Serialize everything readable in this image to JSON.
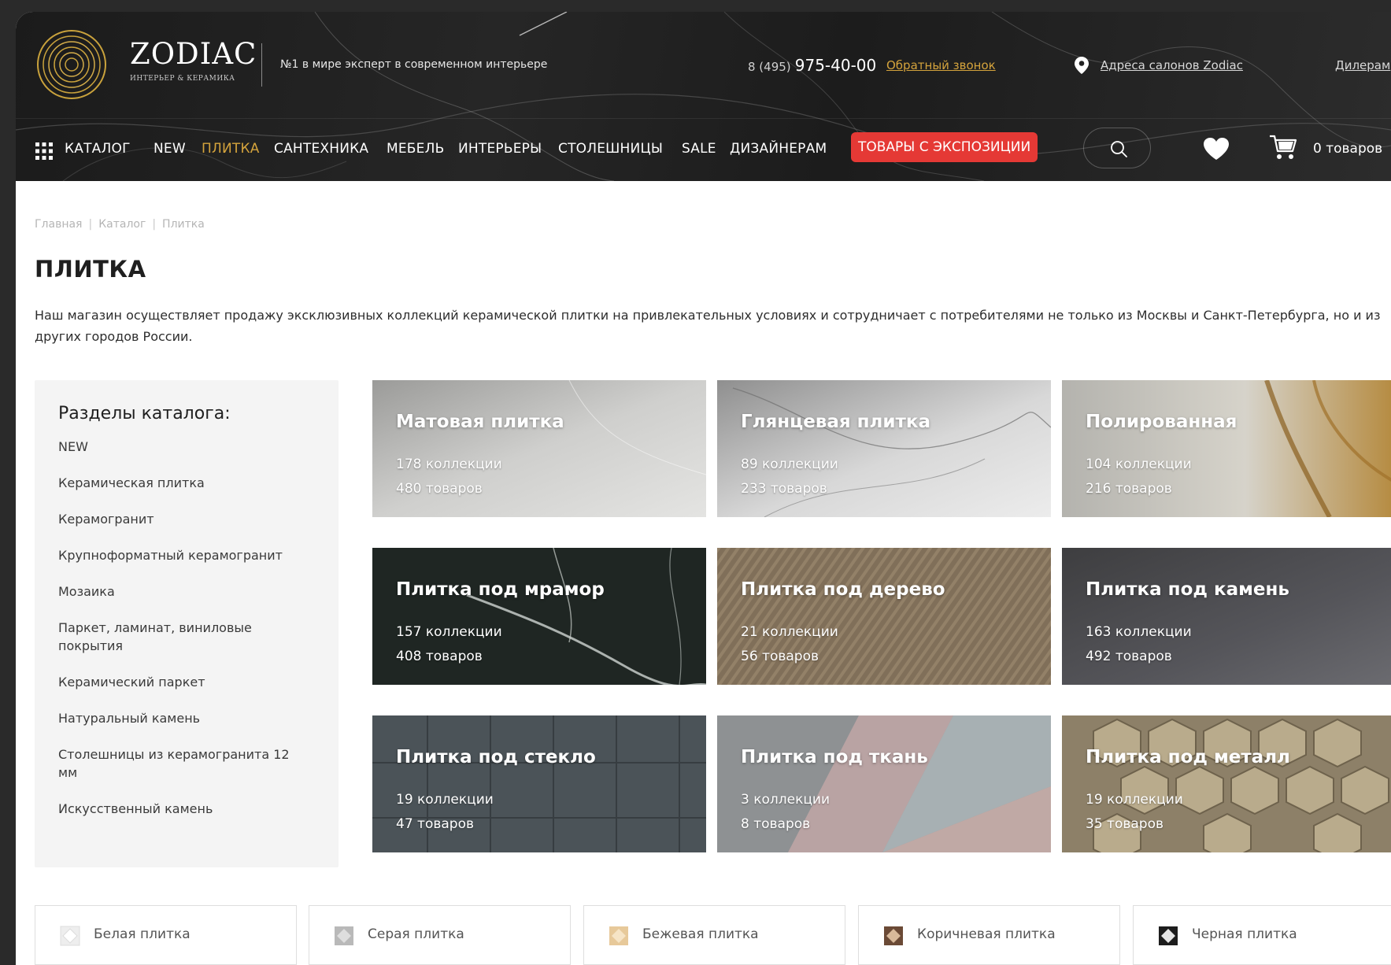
{
  "header": {
    "brand_name": "ZODIAC",
    "brand_sub": "ИНТЕРЬЕР & КЕРАМИКА",
    "tagline": "№1 в мире эксперт в современном интерьере",
    "phone_code": "8 (495)",
    "phone_number": "975-40-00",
    "callback": "Обратный звонок",
    "address": "Адреса салонов Zodiac",
    "dealers": "Дилерам",
    "accent_color": "#d4a33c"
  },
  "nav": {
    "catalog": "КАТАЛОГ",
    "items": [
      "NEW",
      "ПЛИТКА",
      "САНТЕХНИКА",
      "МЕБЕЛЬ",
      "ИНТЕРЬЕРЫ",
      "СТОЛЕШНИЦЫ",
      "SALE",
      "ДИЗАЙНЕРАМ"
    ],
    "active": "ПЛИТКА",
    "expo": "ТОВАРЫ С ЭКСПОЗИЦИИ",
    "expo_color": "#e53935",
    "cart": "0 товаров",
    "icons": [
      "grid-icon",
      "search-icon",
      "heart-icon",
      "cart-icon",
      "map-pin-icon"
    ]
  },
  "breadcrumb": [
    "Главная",
    "Каталог",
    "Плитка"
  ],
  "page": {
    "title": "ПЛИТКА",
    "intro": "Наш магазин осуществляет продажу эксклюзивных коллекций керамической плитки на привлекательных условиях и сотрудничает с потребителями не только из Москвы и Санкт-Петербурга, но и из других городов России."
  },
  "sidebar": {
    "title": "Разделы каталога:",
    "items": [
      "NEW",
      "Керамическая плитка",
      "Керамогранит",
      "Крупноформатный керамогранит",
      "Мозаика",
      "Паркет, ламинат, виниловые покрытия",
      "Керамический паркет",
      "Натуральный камень",
      "Столешницы из керамогранита 12 мм",
      "Искусственный камень"
    ]
  },
  "tiles": [
    {
      "title": "Матовая плитка",
      "collections": "178 коллекции",
      "products": "480 товаров"
    },
    {
      "title": "Глянцевая плитка",
      "collections": "89 коллекции",
      "products": "233 товаров"
    },
    {
      "title": "Полированная",
      "collections": "104 коллекции",
      "products": "216 товаров"
    },
    {
      "title": "Плитка под мрамор",
      "collections": "157 коллекции",
      "products": "408 товаров"
    },
    {
      "title": "Плитка под дерево",
      "collections": "21 коллекции",
      "products": "56 товаров"
    },
    {
      "title": "Плитка под камень",
      "collections": "163 коллекции",
      "products": "492 товаров"
    },
    {
      "title": "Плитка под стекло",
      "collections": "19 коллекции",
      "products": "47 товаров"
    },
    {
      "title": "Плитка под ткань",
      "collections": "3 коллекции",
      "products": "8 товаров"
    },
    {
      "title": "Плитка под металл",
      "collections": "19 коллекции",
      "products": "35 товаров"
    }
  ],
  "colors": [
    {
      "label": "Белая плитка",
      "swatch": "#e8e8e8"
    },
    {
      "label": "Серая плитка",
      "swatch": "#b9b9b9"
    },
    {
      "label": "Бежевая плитка",
      "swatch": "#e7c99a"
    },
    {
      "label": "Коричневая плитка",
      "swatch": "#6b4a36"
    },
    {
      "label": "Черная плитка",
      "swatch": "#1d1d1d"
    }
  ]
}
